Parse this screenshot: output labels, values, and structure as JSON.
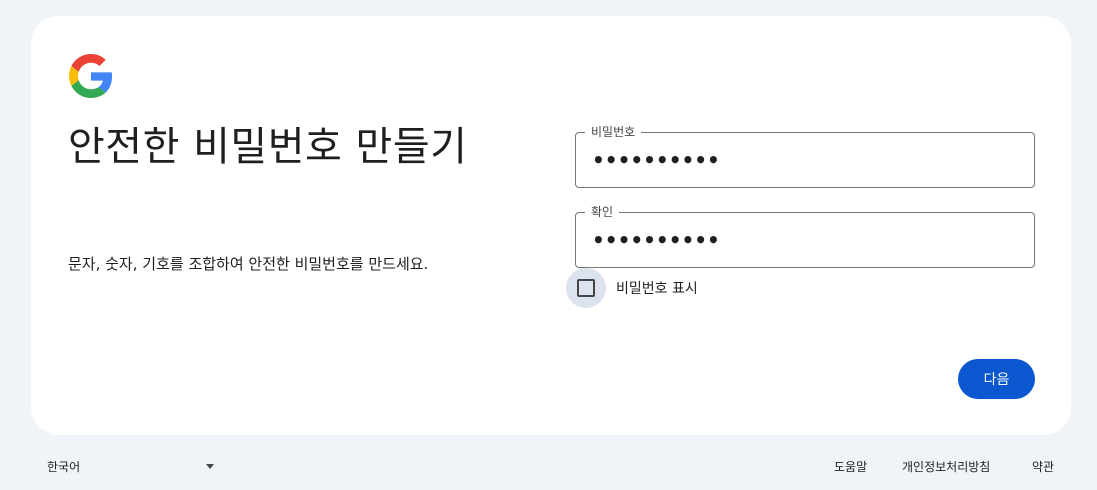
{
  "card": {
    "title": "안전한 비밀번호 만들기",
    "subtitle": "문자, 숫자, 기호를 조합하여 안전한 비밀번호를 만드세요."
  },
  "form": {
    "password_label": "비밀번호",
    "password_value": "••••••••••",
    "confirm_label": "확인",
    "confirm_value": "••••••••••",
    "show_password_label": "비밀번호 표시",
    "show_password_checked": false,
    "next_label": "다음"
  },
  "footer": {
    "language": "한국어",
    "help": "도움말",
    "privacy": "개인정보처리방침",
    "terms": "약관"
  },
  "colors": {
    "accent": "#0b57d0",
    "page_bg": "#f0f4f9",
    "card_bg": "#ffffff"
  },
  "icons": {
    "logo": "google-g-logo",
    "checkbox": "checkbox-unchecked",
    "dropdown": "caret-down-icon"
  }
}
